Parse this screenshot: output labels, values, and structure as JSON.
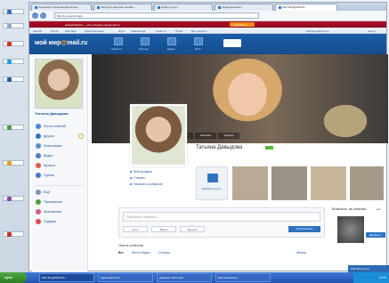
{
  "browser": {
    "tabs": [
      {
        "label": "Подписки и облагающий вопрос…"
      },
      {
        "label": "Смотреть фильмы онлайн…"
      },
      {
        "label": "Новости дня…"
      },
      {
        "label": "Одноклассники…"
      },
      {
        "label": "Мой Мир@Mail.Ru"
      }
    ],
    "address": "http://my.mail.ru/mail/…"
  },
  "redbar": {
    "left_text": "Новый Mail.Ru — все письма в одном месте",
    "mid_text": "Установить"
  },
  "mailbar": {
    "items": [
      "Mail.Ru",
      "Почта",
      "Мой Мир",
      "Одноклассники",
      "Игры",
      "Знакомства",
      "Новости",
      "Поиск",
      "Все проекты"
    ],
    "user": "t.davydova@mail.ru",
    "exit": "выход"
  },
  "site_header": {
    "logo_part1": "мой мир",
    "logo_at": "@",
    "logo_part2": "mail.ru",
    "nav": [
      "Новости",
      "Музыка",
      "Видео",
      "Фото"
    ],
    "create_btn": "Поделиться",
    "colors": {
      "header": "#1c5ea8",
      "accent": "#ffa31a"
    }
  },
  "sidebar": {
    "name": "Татьяна Давыдова",
    "menu": [
      {
        "label": "Лента событий",
        "icon": "newsfeed-icon",
        "color": "#4a89d2"
      },
      {
        "label": "Друзья",
        "icon": "friends-icon",
        "color": "#2e73c2"
      },
      {
        "label": "Фотографии",
        "icon": "photos-icon",
        "color": "#5a8dcc"
      },
      {
        "label": "Видео",
        "icon": "video-icon",
        "color": "#4a7fc0"
      },
      {
        "label": "Музыка",
        "icon": "music-icon",
        "color": "#e0544a"
      },
      {
        "label": "Группы",
        "icon": "groups-icon",
        "color": "#3f7cc4"
      }
    ],
    "section2": [
      {
        "label": "Ещё",
        "icon": "more-icon",
        "color": "#7b95b8"
      },
      {
        "label": "Приложения",
        "icon": "apps-icon",
        "color": "#4f9c3d"
      },
      {
        "label": "Знакомства",
        "icon": "dating-icon",
        "color": "#d35a8c"
      },
      {
        "label": "Подарки",
        "icon": "gifts-icon",
        "color": "#e04a4a"
      }
    ]
  },
  "cover": {
    "buttons": [
      "Сменить",
      "Обложка",
      "Удалить"
    ]
  },
  "profile": {
    "name": "Татьяна Давыдова",
    "status_label": "",
    "sub": "",
    "links": [
      "Мой профиль",
      "Статусы",
      "Написать сообщение"
    ],
    "add_photo": "Добавить фото"
  },
  "photos": [
    {
      "color": "#b9aa94"
    },
    {
      "color": "#9a9386"
    },
    {
      "color": "#c8b79d"
    },
    {
      "color": "#a59a88"
    },
    {
      "color": "#8c8172"
    }
  ],
  "composer": {
    "placeholder": "Поделитесь новостью…",
    "buttons": [
      "Фото",
      "Видео",
      "Музыка"
    ],
    "post": "Опубликовать"
  },
  "events": {
    "title": "Лента событий",
    "tabs": [
      "Все",
      "Фото и Видео",
      "Статусы"
    ],
    "selected_tab": "Все",
    "filter": "Фильтр"
  },
  "maybe_know": {
    "title": "Возможно, вы знакомы",
    "all": "все",
    "name": "",
    "add_button": "Добавить"
  },
  "chat": {
    "label": "Мой Мир Агент"
  },
  "taskbar": {
    "start": "пуск",
    "items": [
      "Мой Мир@Mail.Ru…",
      "Одноклассники…",
      "Документ Microsoft…",
      "Мой компьютер"
    ],
    "clock": "12:41"
  },
  "desktop": {
    "icons": [
      {
        "label": "Мой комп…",
        "color": "#3d6fb6"
      },
      {
        "label": "Корзина",
        "color": "#8aa6c9"
      },
      {
        "label": "Opera",
        "color": "#d2302a"
      },
      {
        "label": "Skype",
        "color": "#1fa0e0"
      },
      {
        "label": "Word",
        "color": "#2b5aa8"
      },
      {
        "label": "Игры",
        "color": "#4f9c3d"
      },
      {
        "label": "Фото",
        "color": "#e49a22"
      },
      {
        "label": "Музыка",
        "color": "#8e44ad"
      },
      {
        "label": "Видео",
        "color": "#c0392b"
      }
    ]
  }
}
